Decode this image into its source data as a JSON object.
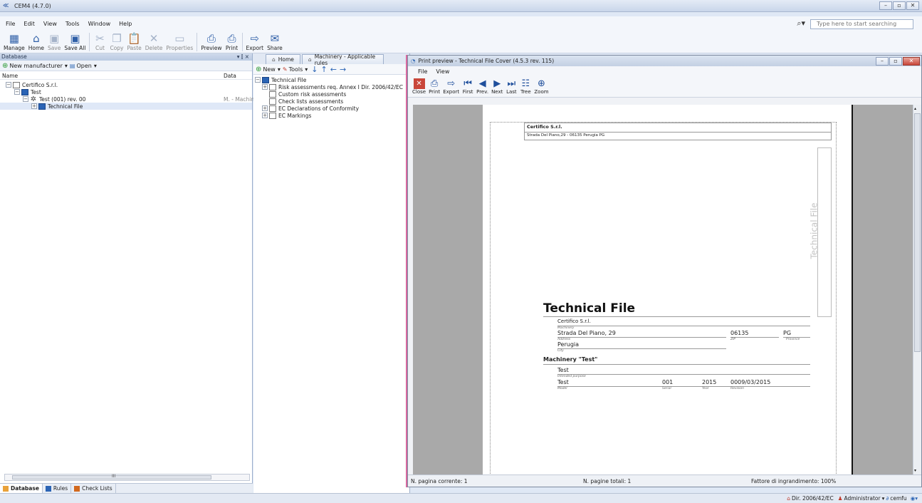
{
  "window": {
    "title": "CEM4 (4.7.0)",
    "app_icon": "cem4-logo-icon",
    "controls": [
      "minimize-icon",
      "restore-icon",
      "close-icon"
    ]
  },
  "menu": {
    "items": [
      "File",
      "Edit",
      "View",
      "Tools",
      "Window",
      "Help"
    ],
    "search_placeholder": "Type here to start searching"
  },
  "toolbar": {
    "buttons": [
      {
        "label": "Manage",
        "icon": "manage-icon",
        "enabled": true
      },
      {
        "label": "Home",
        "icon": "home-icon",
        "enabled": true
      },
      {
        "label": "Save",
        "icon": "save-icon",
        "enabled": false
      },
      {
        "label": "Save All",
        "icon": "save-all-icon",
        "enabled": true
      },
      {
        "label": "Cut",
        "icon": "cut-icon",
        "enabled": false
      },
      {
        "label": "Copy",
        "icon": "copy-icon",
        "enabled": false
      },
      {
        "label": "Paste",
        "icon": "paste-icon",
        "enabled": false
      },
      {
        "label": "Delete",
        "icon": "delete-icon",
        "enabled": false
      },
      {
        "label": "Properties",
        "icon": "properties-icon",
        "enabled": false
      },
      {
        "label": "Preview",
        "icon": "preview-icon",
        "enabled": true
      },
      {
        "label": "Print",
        "icon": "print-icon",
        "enabled": true
      },
      {
        "label": "Export",
        "icon": "export-icon",
        "enabled": true
      },
      {
        "label": "Share",
        "icon": "share-icon",
        "enabled": true
      }
    ]
  },
  "database_panel": {
    "title": "Database",
    "panel_controls": "▾ ⫿ ×",
    "new_manufacturer": "New manufacturer",
    "open": "Open",
    "col_name": "Name",
    "col_data": "Data",
    "tree": [
      {
        "label": "Certifico S.r.l.",
        "indent": 0,
        "icon": "manufacturer-icon",
        "data": ""
      },
      {
        "label": "Test",
        "indent": 1,
        "icon": "machine-icon",
        "data": ""
      },
      {
        "label": "Test (001) rev. 00",
        "indent": 2,
        "icon": "gear-icon",
        "data": "M. - Machin"
      },
      {
        "label": "Technical File",
        "indent": 3,
        "icon": "technical-file-icon",
        "data": ""
      }
    ],
    "scroll_mark": "III",
    "bottom_tabs": [
      "Database",
      "Rules",
      "Check Lists"
    ]
  },
  "doc_tabs": [
    "Home",
    "Machinery - Applicable rules"
  ],
  "tech_panel": {
    "new": "New",
    "tools": "Tools",
    "tree": [
      {
        "label": "Technical File",
        "indent": 0
      },
      {
        "label": "Risk assessments req. Annex I Dir. 2006/42/EC",
        "indent": 1
      },
      {
        "label": "Custom risk assessments",
        "indent": 1
      },
      {
        "label": "Check lists assessments",
        "indent": 1
      },
      {
        "label": "EC Declarations of Conformity",
        "indent": 1
      },
      {
        "label": "EC Markings",
        "indent": 1
      }
    ]
  },
  "preview": {
    "title": "Print preview - Technical File Cover (4.5.3 rev. 115)",
    "menu": [
      "File",
      "View"
    ],
    "buttons": [
      "Close",
      "Print",
      "Export",
      "First",
      "Prev.",
      "Next",
      "Last",
      "Tree",
      "Zoom"
    ],
    "page": {
      "header_company": "Certifico S.r.l.",
      "header_address": "Strada Del Piano,29 - 06135 Perugia PG",
      "side_label": "Technical File",
      "heading": "Technical File",
      "manufacturer": "Certifico S.r.l.",
      "manufacturer_caption": "Machinery",
      "address": "Strada Del Piano, 29",
      "address_caption": "Address",
      "zip": "06135",
      "zip_caption": "ZIP",
      "province": "PG",
      "province_caption": "Province",
      "city": "Perugia",
      "city_caption": "City",
      "machinery_heading": "Machinery \"Test\"",
      "intended_purpose": "Test",
      "intended_caption": "Intended purpose",
      "model": "Test",
      "model_caption": "Model",
      "serial": "001",
      "serial_caption": "Serial",
      "year": "2015",
      "year_caption": "Year",
      "revision": "0009/03/2015",
      "revision_caption": "Revision"
    },
    "status_current": "N. pagina corrente: 1",
    "status_total": "N. pagine totali: 1",
    "status_zoom": "Fattore di ingrandimento: 100%"
  },
  "statusbar": {
    "directive": "Dir. 2006/42/EC",
    "user_role": "Administrator",
    "user": "cemfu"
  }
}
